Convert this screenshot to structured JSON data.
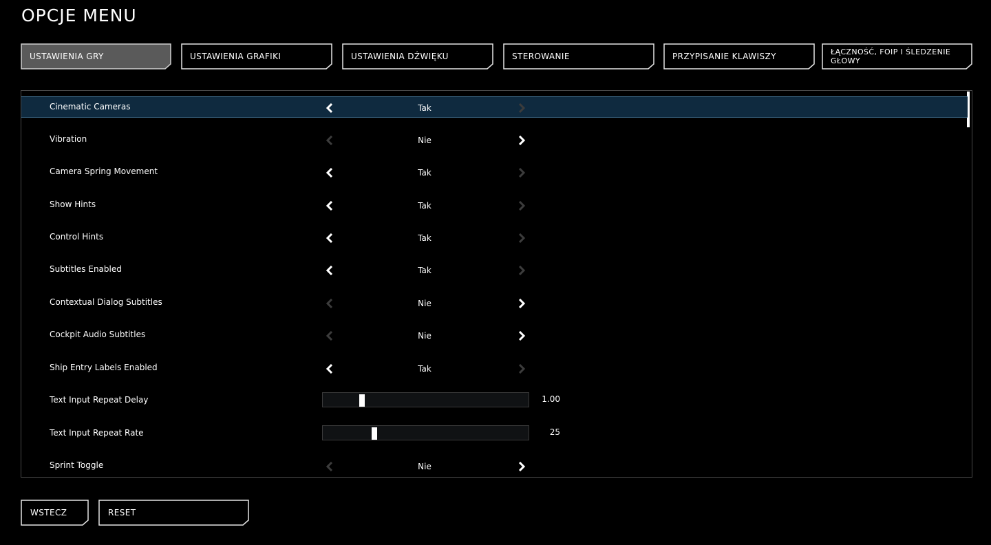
{
  "title": "OPCJE MENU",
  "tabs": [
    {
      "label": "USTAWIENIA GRY",
      "active": true
    },
    {
      "label": "USTAWIENIA GRAFIKI",
      "active": false
    },
    {
      "label": "USTAWIENIA DŹWIĘKU",
      "active": false
    },
    {
      "label": "STEROWANIE",
      "active": false
    },
    {
      "label": "PRZYPISANIE KLAWISZY",
      "active": false
    },
    {
      "label": "ŁĄCZNOŚĆ, FOIP I ŚLEDZENIE GŁOWY",
      "active": false
    }
  ],
  "settings": [
    {
      "label": "Cinematic Cameras",
      "type": "toggle",
      "value": "Tak",
      "left_enabled": true,
      "right_enabled": false,
      "selected": true
    },
    {
      "label": "Vibration",
      "type": "toggle",
      "value": "Nie",
      "left_enabled": false,
      "right_enabled": true,
      "selected": false
    },
    {
      "label": "Camera Spring Movement",
      "type": "toggle",
      "value": "Tak",
      "left_enabled": true,
      "right_enabled": false,
      "selected": false
    },
    {
      "label": "Show Hints",
      "type": "toggle",
      "value": "Tak",
      "left_enabled": true,
      "right_enabled": false,
      "selected": false
    },
    {
      "label": "Control Hints",
      "type": "toggle",
      "value": "Tak",
      "left_enabled": true,
      "right_enabled": false,
      "selected": false
    },
    {
      "label": "Subtitles Enabled",
      "type": "toggle",
      "value": "Tak",
      "left_enabled": true,
      "right_enabled": false,
      "selected": false
    },
    {
      "label": "Contextual Dialog Subtitles",
      "type": "toggle",
      "value": "Nie",
      "left_enabled": false,
      "right_enabled": true,
      "selected": false
    },
    {
      "label": "Cockpit Audio Subtitles",
      "type": "toggle",
      "value": "Nie",
      "left_enabled": false,
      "right_enabled": true,
      "selected": false
    },
    {
      "label": "Ship Entry Labels Enabled",
      "type": "toggle",
      "value": "Tak",
      "left_enabled": true,
      "right_enabled": false,
      "selected": false
    },
    {
      "label": "Text Input Repeat Delay",
      "type": "slider",
      "value": "1.00",
      "fraction": 0.19,
      "selected": false
    },
    {
      "label": "Text Input Repeat Rate",
      "type": "slider",
      "value": "25",
      "fraction": 0.25,
      "selected": false
    },
    {
      "label": "Sprint Toggle",
      "type": "toggle",
      "value": "Nie",
      "left_enabled": false,
      "right_enabled": true,
      "selected": false
    }
  ],
  "buttons": {
    "back": "WSTECZ",
    "reset": "RESET"
  },
  "colors": {
    "background": "#000000",
    "selected_row": "#0f2a3f",
    "active_tab": "#5a5a5a",
    "disabled_arrow": "#3c3c3c",
    "enabled_arrow": "#ffffff"
  }
}
